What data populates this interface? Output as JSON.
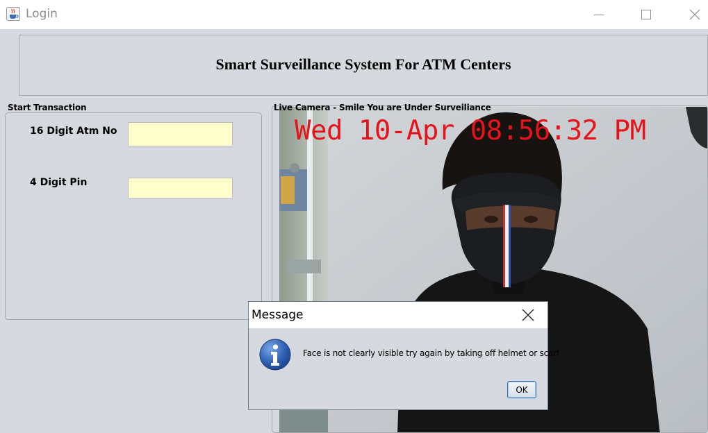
{
  "window": {
    "title": "Login",
    "icon": "java-cup-icon"
  },
  "header": {
    "title": "Smart Surveillance System For ATM Centers"
  },
  "transaction": {
    "section_label": "Start Transaction",
    "atm_label": "16 Digit Atm No",
    "atm_value": "",
    "pin_label": "4 Digit Pin",
    "pin_value": ""
  },
  "camera": {
    "section_label": "Live Camera - Smile You are Under Surveiliance",
    "timestamp": "Wed 10-Apr 08:56:32 PM",
    "timestamp_color": "#e5141a"
  },
  "dialog": {
    "title": "Message",
    "icon": "info-icon",
    "message": "Face is not clearly visible try again by taking off helmet or scarf",
    "ok_label": "OK"
  },
  "colors": {
    "panel_bg": "#d6d9df",
    "input_bg": "#ffffcc",
    "info_blue": "#2d5fb3"
  }
}
